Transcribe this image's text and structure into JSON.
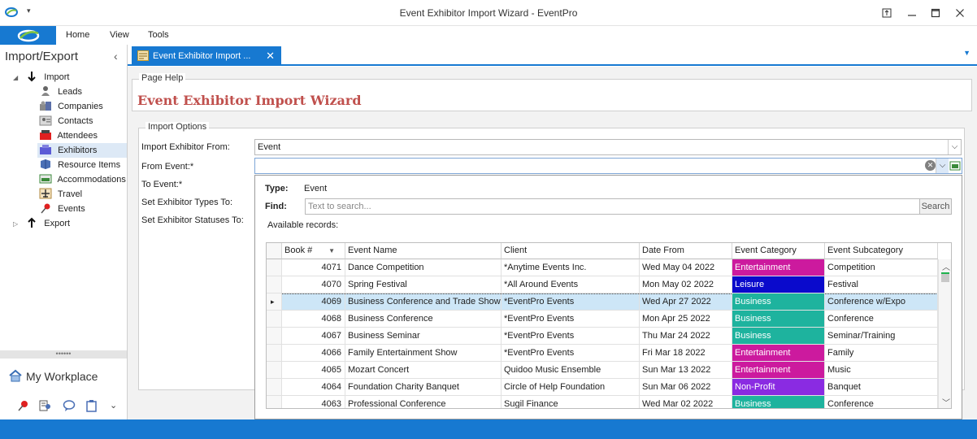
{
  "window": {
    "title": "Event Exhibitor Import Wizard - EventPro"
  },
  "ribbon": {
    "tabs": [
      "Home",
      "View",
      "Tools"
    ]
  },
  "sidebar": {
    "title": "Import/Export",
    "tree": [
      {
        "label": "Import",
        "icon": "arrow-down-icon",
        "level": 0,
        "expanded": true
      },
      {
        "label": "Leads",
        "icon": "person-icon",
        "level": 1
      },
      {
        "label": "Companies",
        "icon": "building-icon",
        "level": 1
      },
      {
        "label": "Contacts",
        "icon": "contact-card-icon",
        "level": 1
      },
      {
        "label": "Attendees",
        "icon": "attendees-icon",
        "level": 1
      },
      {
        "label": "Exhibitors",
        "icon": "exhibitor-booth-icon",
        "level": 1,
        "selected": true
      },
      {
        "label": "Resource Items",
        "icon": "resource-box-icon",
        "level": 1
      },
      {
        "label": "Accommodations",
        "icon": "bed-icon",
        "level": 1
      },
      {
        "label": "Travel",
        "icon": "airplane-icon",
        "level": 1
      },
      {
        "label": "Events",
        "icon": "pushpin-icon",
        "level": 1
      },
      {
        "label": "Export",
        "icon": "arrow-up-icon",
        "level": 0,
        "expanded": false
      }
    ],
    "splitter": "••••••",
    "workplace": {
      "label": "My Workplace"
    }
  },
  "doc_tab": {
    "label": "Event Exhibitor Import ..."
  },
  "page_help": {
    "legend": "Page Help",
    "heading": "Event Exhibitor Import Wizard"
  },
  "import_options": {
    "legend": "Import Options",
    "fields": [
      {
        "label": "Import Exhibitor From:",
        "value": "Event"
      },
      {
        "label": "From Event:*",
        "value": ""
      },
      {
        "label": "To Event:*"
      },
      {
        "label": "Set Exhibitor Types To:"
      },
      {
        "label": "Set Exhibitor Statuses To:"
      }
    ]
  },
  "lookup": {
    "type_label": "Type:",
    "type_value": "Event",
    "find_label": "Find:",
    "search_placeholder": "Text to search...",
    "search_button": "Search",
    "available_label": "Available records:",
    "columns": [
      "Book #",
      "Event Name",
      "Client",
      "Date From",
      "Event Category",
      "Event Subcategory"
    ],
    "rows": [
      {
        "book": "4071",
        "name": "Dance Competition",
        "client": "*Anytime Events Inc.",
        "date": "Wed May 04 2022",
        "category": "Entertainment",
        "cat_color": "#cc1a9e",
        "subcategory": "Competition"
      },
      {
        "book": "4070",
        "name": "Spring Festival",
        "client": "*All Around Events",
        "date": "Mon May 02 2022",
        "category": "Leisure",
        "cat_color": "#0a0acc",
        "subcategory": "Festival"
      },
      {
        "book": "4069",
        "name": "Business Conference and Trade Show",
        "client": "*EventPro Events",
        "date": "Wed Apr 27 2022",
        "category": "Business",
        "cat_color": "#1eb39e",
        "subcategory": "Conference w/Expo",
        "selected": true
      },
      {
        "book": "4068",
        "name": "Business Conference",
        "client": "*EventPro Events",
        "date": "Mon Apr 25 2022",
        "category": "Business",
        "cat_color": "#1eb39e",
        "subcategory": "Conference"
      },
      {
        "book": "4067",
        "name": "Business Seminar",
        "client": "*EventPro Events",
        "date": "Thu Mar 24 2022",
        "category": "Business",
        "cat_color": "#1eb39e",
        "subcategory": "Seminar/Training"
      },
      {
        "book": "4066",
        "name": "Family Entertainment Show",
        "client": "*EventPro Events",
        "date": "Fri Mar 18 2022",
        "category": "Entertainment",
        "cat_color": "#cc1a9e",
        "subcategory": "Family"
      },
      {
        "book": "4065",
        "name": "Mozart Concert",
        "client": "Quidoo Music Ensemble",
        "date": "Sun Mar 13 2022",
        "category": "Entertainment",
        "cat_color": "#cc1a9e",
        "subcategory": "Music"
      },
      {
        "book": "4064",
        "name": "Foundation Charity Banquet",
        "client": "Circle of Help Foundation",
        "date": "Sun Mar 06 2022",
        "category": "Non-Profit",
        "cat_color": "#8a2be2",
        "subcategory": "Banquet"
      },
      {
        "book": "4063",
        "name": "Professional Conference",
        "client": "Sugil Finance",
        "date": "Wed Mar 02 2022",
        "category": "Business",
        "cat_color": "#1eb39e",
        "subcategory": "Conference"
      }
    ]
  },
  "colors": {
    "accent": "#1779d1",
    "heading": "#c0504d",
    "selected_row": "#cde6f7"
  }
}
